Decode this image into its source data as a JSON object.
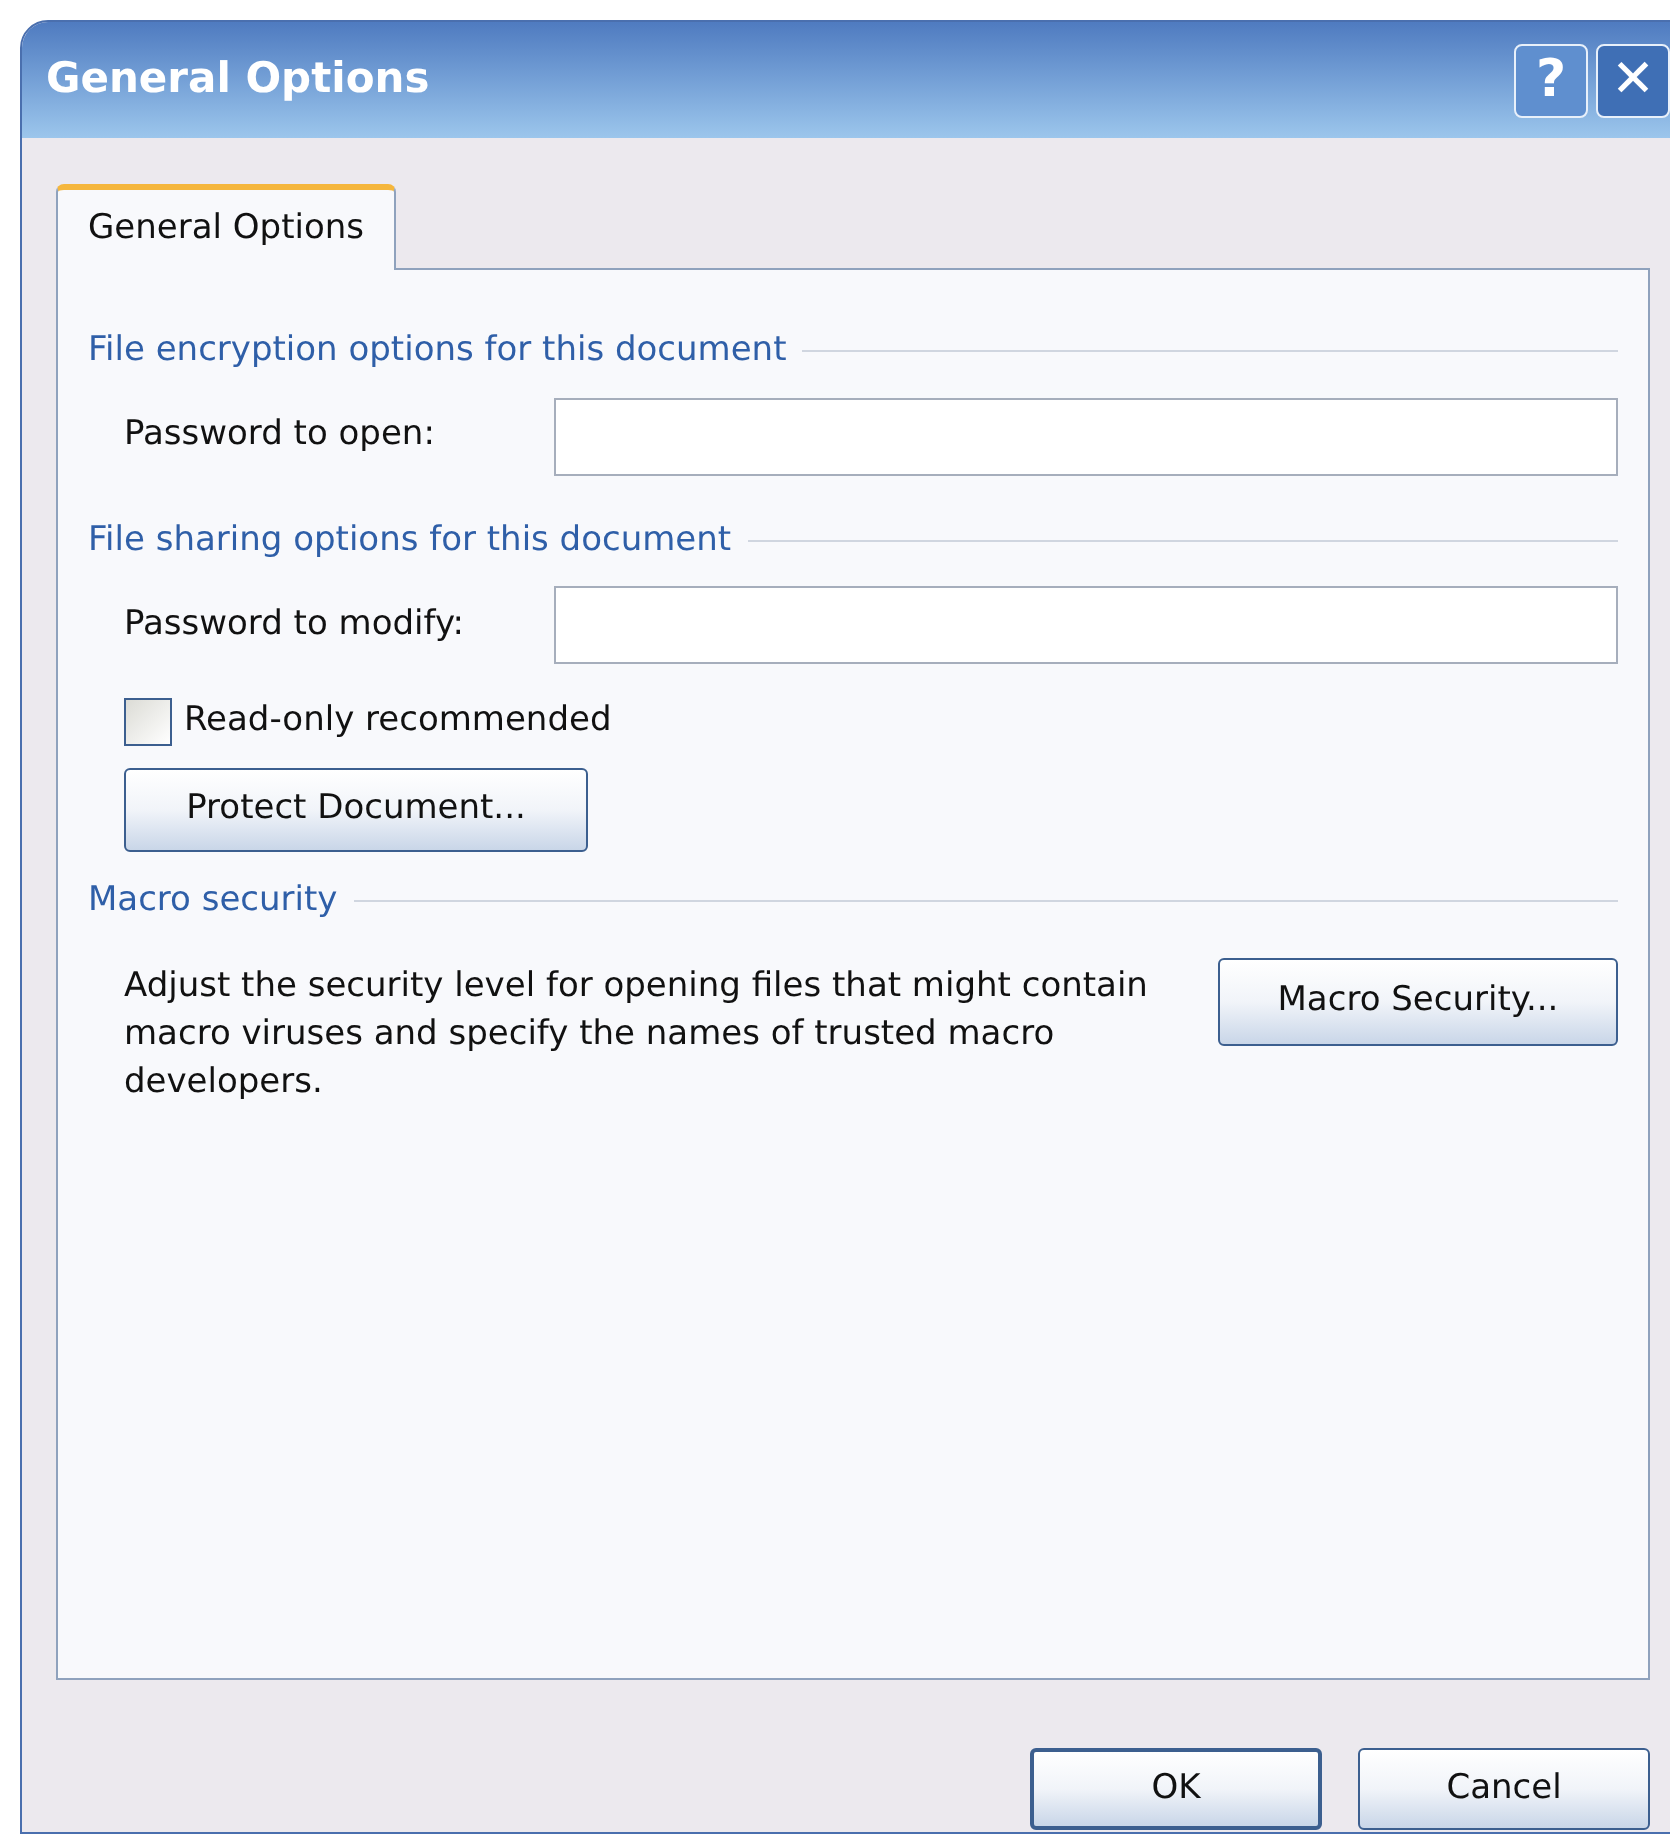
{
  "window": {
    "title": "General Options",
    "title_buttons": [
      {
        "kind": "help",
        "label": "?"
      },
      {
        "kind": "close",
        "label": "✕"
      }
    ]
  },
  "tabs": [
    {
      "label": "General Options",
      "selected": true
    }
  ],
  "encryption": {
    "heading": "File encryption options for this document",
    "password_label": "Password to open:"
  },
  "sharing": {
    "heading": "File sharing options for this document",
    "password_label": "Password to modify:",
    "read_only": {
      "label": "Read-only recommended",
      "checked": false
    },
    "protect_button": "Protect Document..."
  },
  "macro": {
    "heading": "Macro security",
    "description": "Adjust the security level for opening files that might contain macro viruses and specify the names of trusted macro developers.",
    "button": "Macro Security..."
  },
  "buttons": [
    {
      "label": "OK",
      "default": true
    },
    {
      "label": "Cancel",
      "default": false
    }
  ]
}
